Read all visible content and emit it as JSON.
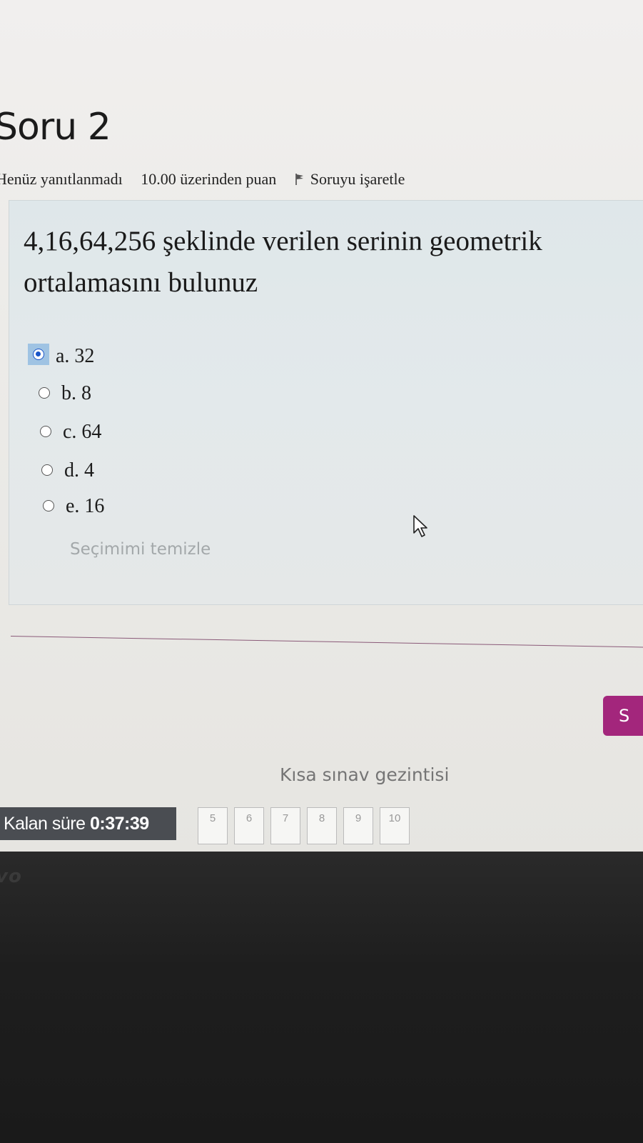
{
  "question": {
    "title": "Soru 2",
    "status": "Henüz yanıtlanmadı",
    "points": "10.00 üzerinden puan",
    "flag_label": "Soruyu işaretle",
    "text": "4,16,64,256 şeklinde verilen serinin geometrik ortalamasını bulunuz"
  },
  "answers": [
    {
      "label": "a. 32",
      "selected": true
    },
    {
      "label": "b. 8",
      "selected": false
    },
    {
      "label": "c. 64",
      "selected": false
    },
    {
      "label": "d. 4",
      "selected": false
    },
    {
      "label": "e. 16",
      "selected": false
    }
  ],
  "clear_choice": "Seçimimi temizle",
  "next_button": "S",
  "quiz_nav": {
    "title": "Kısa sınav gezintisi",
    "timer_label": "Kalan süre",
    "timer_value": "0:37:39",
    "pages": [
      "5",
      "6",
      "7",
      "8",
      "9",
      "10"
    ]
  },
  "bezel_logo": "vo",
  "colors": {
    "accent": "#a3267c",
    "selected_radio": "#1a55c8",
    "panel": "#e3e9eb"
  }
}
